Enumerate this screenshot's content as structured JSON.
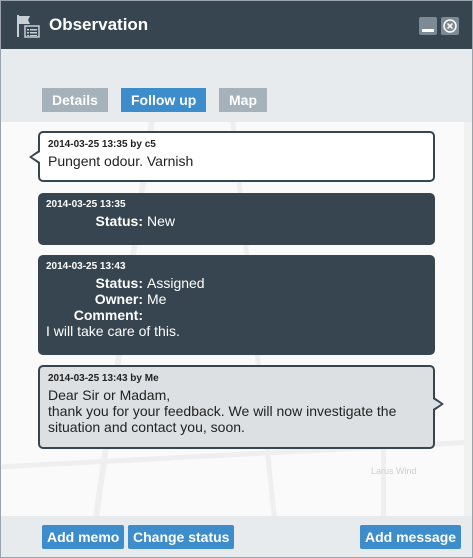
{
  "window": {
    "title": "Observation",
    "icon": "observation-list-icon",
    "minimize_icon": "minimize-icon",
    "close_icon": "close-circle-icon"
  },
  "tabs": [
    {
      "label": "Details",
      "active": false
    },
    {
      "label": "Follow up",
      "active": true
    },
    {
      "label": "Map",
      "active": false
    }
  ],
  "background_map": {
    "labels": [
      "Larus Wind"
    ]
  },
  "messages": [
    {
      "style": "incoming",
      "meta": "2014-03-25 13:35 by c5",
      "lines": [
        "Pungent odour. Varnish"
      ]
    },
    {
      "style": "system",
      "meta": "2014-03-25 13:35",
      "fields": [
        {
          "key": "Status:",
          "value": "New"
        }
      ]
    },
    {
      "style": "system",
      "meta": "2014-03-25 13:43",
      "fields": [
        {
          "key": "Status:",
          "value": "Assigned"
        },
        {
          "key": "Owner:",
          "value": "Me"
        },
        {
          "key": "Comment:",
          "value": ""
        }
      ],
      "lines": [
        "I will take care of this."
      ]
    },
    {
      "style": "outgoing",
      "meta": "2014-03-25 13:43 by Me",
      "lines": [
        "Dear Sir or Madam,",
        "thank you for your feedback. We will now investigate the",
        "situation and contact you, soon."
      ]
    }
  ],
  "footer": {
    "add_memo": "Add memo",
    "change_status": "Change status",
    "add_message": "Add message"
  },
  "colors": {
    "titlebar": "#36454f",
    "accent": "#3d8ccc",
    "tab_inactive": "#a5b1bb",
    "panel": "#e8ebee"
  }
}
